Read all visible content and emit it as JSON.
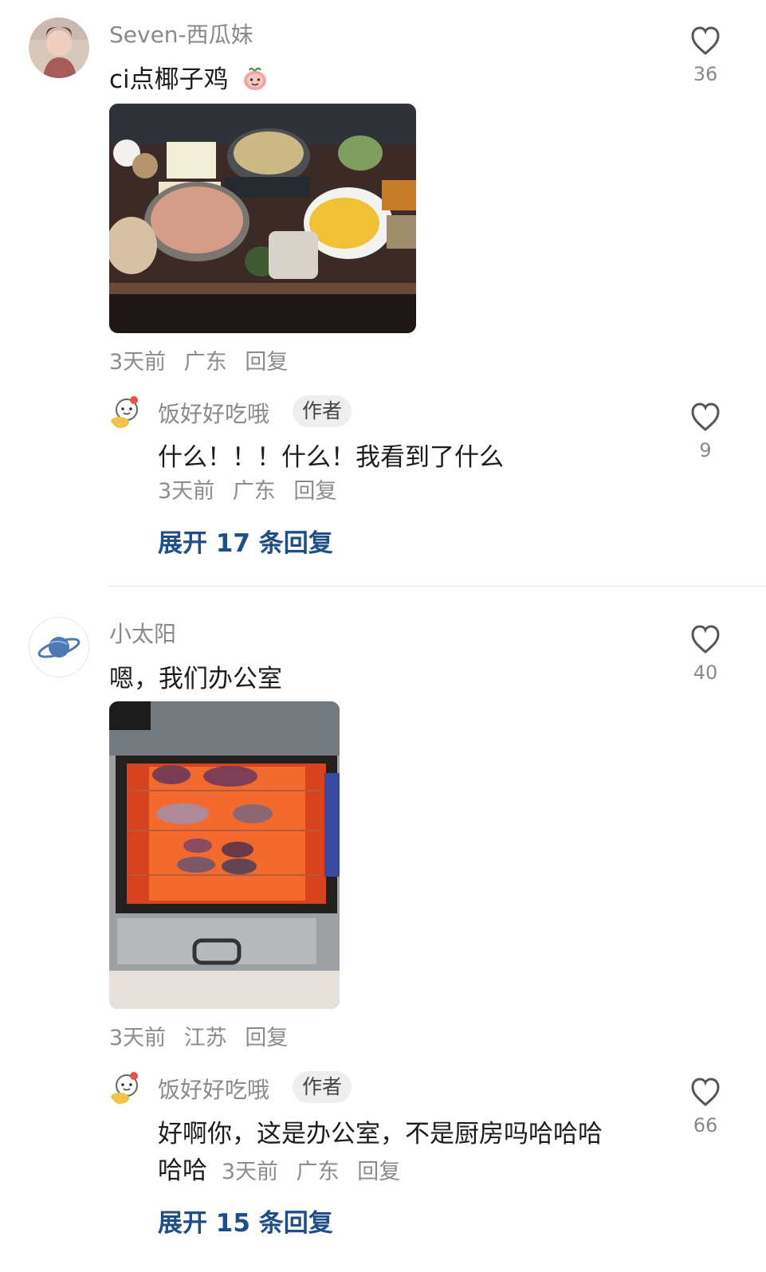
{
  "comments": [
    {
      "username": "Seven-西瓜妹",
      "text": "ci点椰子鸡",
      "emoji_icon": "peach-face-emoji-icon",
      "time": "3天前",
      "location": "广东",
      "reply_label": "回复",
      "likes": "36",
      "image_alt": "hotpot-table-photo",
      "reply": {
        "username": "饭好好吃哦",
        "badge": "作者",
        "text": "什么！！！什么！我看到了什么",
        "time": "3天前",
        "location": "广东",
        "reply_label": "回复",
        "likes": "9"
      },
      "expand_label": "展开 17 条回复"
    },
    {
      "username": "小太阳",
      "text": "嗯，我们办公室",
      "time": "3天前",
      "location": "江苏",
      "reply_label": "回复",
      "likes": "40",
      "image_alt": "sweet-potato-oven-photo",
      "reply": {
        "username": "饭好好吃哦",
        "badge": "作者",
        "text_line1": "好啊你，这是办公室，不是厨房吗哈哈哈",
        "text_line2": "哈哈",
        "time": "3天前",
        "location": "广东",
        "reply_label": "回复",
        "likes": "66"
      },
      "expand_label": "展开 15 条回复"
    }
  ],
  "colors": {
    "accent": "#1f4f86",
    "muted_text": "#8a8a8a",
    "divider": "#e5e5e5",
    "badge_bg": "#eeeeee"
  }
}
